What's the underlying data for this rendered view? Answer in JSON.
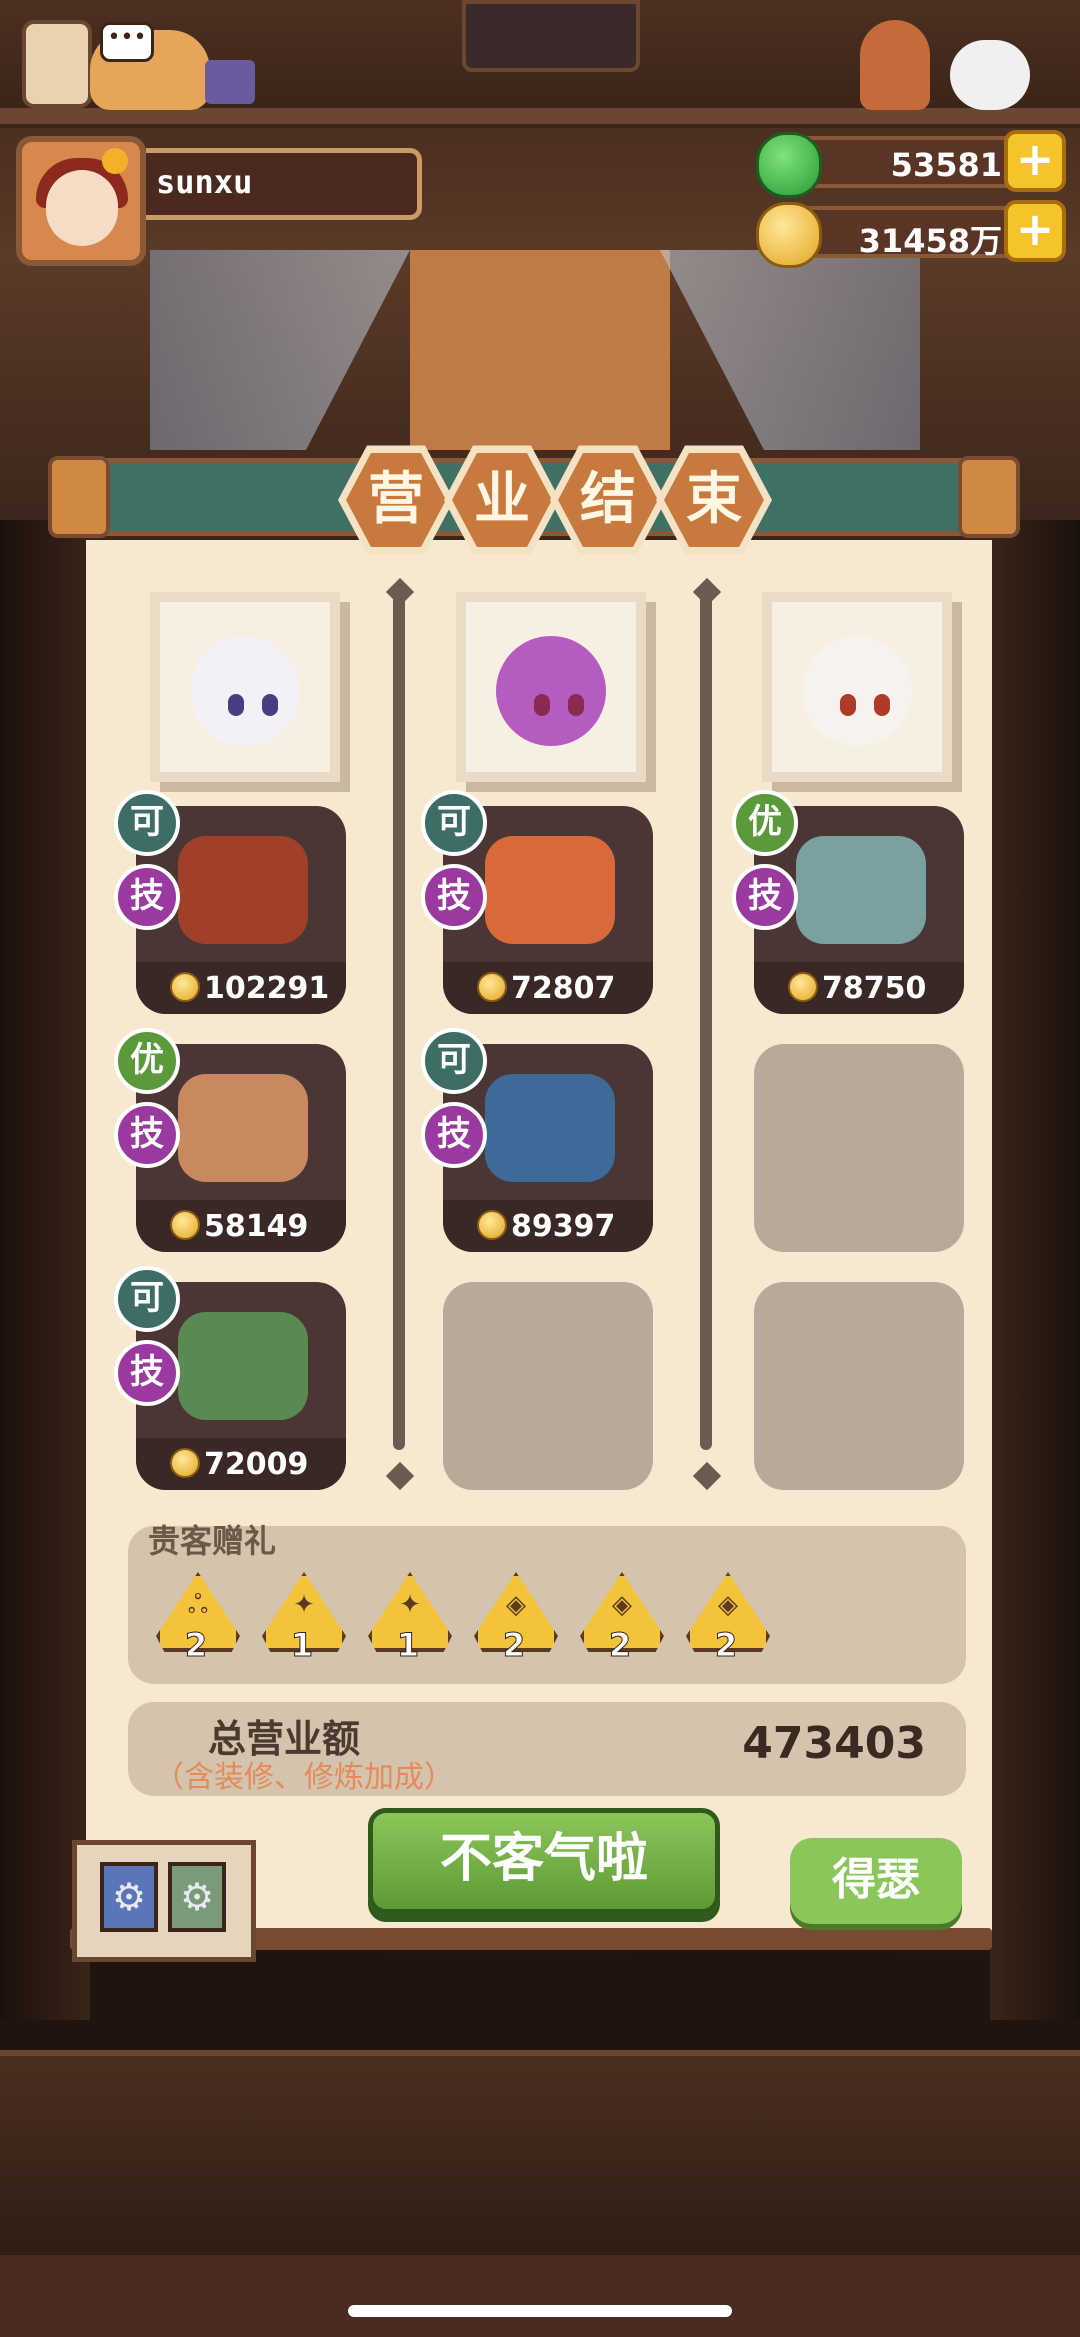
{
  "player": {
    "name": "sunxu"
  },
  "resources": {
    "jade": "53581",
    "gold": "31458万",
    "plus": "+"
  },
  "title_chars": [
    "营",
    "业",
    "结",
    "束"
  ],
  "columns": [
    {
      "dishes": [
        {
          "badge_top": "可",
          "badge_skill": "技",
          "value": "102291"
        },
        {
          "badge_top": "优",
          "badge_skill": "技",
          "value": "58149"
        },
        {
          "badge_top": "可",
          "badge_skill": "技",
          "value": "72009"
        }
      ]
    },
    {
      "dishes": [
        {
          "badge_top": "可",
          "badge_skill": "技",
          "value": "72807"
        },
        {
          "badge_top": "可",
          "badge_skill": "技",
          "value": "89397"
        }
      ]
    },
    {
      "dishes": [
        {
          "badge_top": "优",
          "badge_skill": "技",
          "value": "78750"
        }
      ]
    }
  ],
  "gifts": {
    "title": "贵客赠礼",
    "items": [
      {
        "count": "2"
      },
      {
        "count": "1"
      },
      {
        "count": "1"
      },
      {
        "count": "2"
      },
      {
        "count": "2"
      },
      {
        "count": "2"
      }
    ]
  },
  "total": {
    "label": "总营业额",
    "note": "（含装修、修炼加成）",
    "value": "473403"
  },
  "buttons": {
    "confirm": "不客气啦",
    "brag": "得瑟"
  },
  "colors": {
    "title_bar": "#3e7066",
    "panel_bg": "#f7e9d0",
    "button_green": "#7cb84a",
    "badge_ke": "#3e6c66",
    "badge_you": "#5a9a3a",
    "badge_ji": "#9a3aa0"
  },
  "icons": {
    "jade": "jade-coin-icon",
    "gold": "gold-coin-icon",
    "gift": "gift-token-icon",
    "settings": "gear-icon"
  }
}
